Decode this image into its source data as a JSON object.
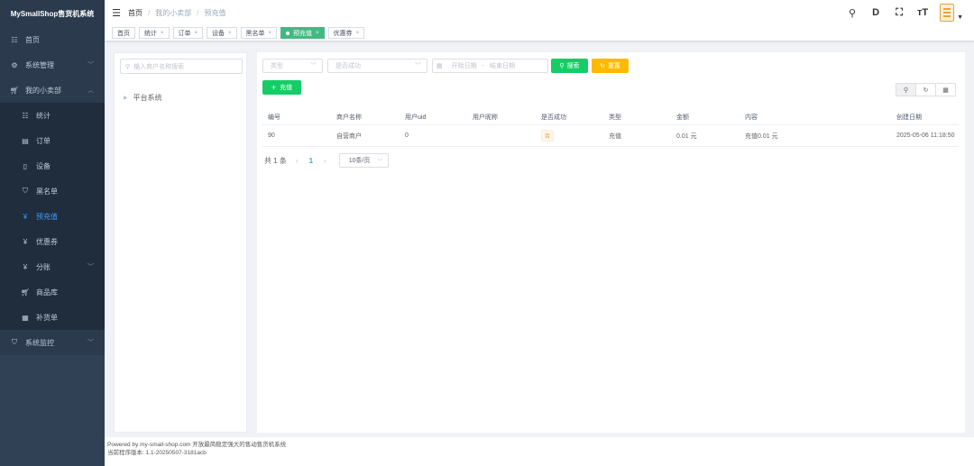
{
  "app": {
    "title": "MySmallShop售货机系统"
  },
  "sidebar": {
    "items": [
      {
        "label": "首页",
        "icon": "dashboard-icon"
      },
      {
        "label": "系统管理",
        "icon": "gear-icon"
      },
      {
        "label": "我的小卖部",
        "icon": "cart-icon"
      },
      {
        "label": "系统监控",
        "icon": "monitor-icon"
      }
    ],
    "sub_items": [
      {
        "label": "统计",
        "icon": "chart-icon"
      },
      {
        "label": "订单",
        "icon": "order-icon"
      },
      {
        "label": "设备",
        "icon": "device-icon"
      },
      {
        "label": "黑名单",
        "icon": "shield-icon"
      },
      {
        "label": "预充值",
        "icon": "yen-icon"
      },
      {
        "label": "优惠券",
        "icon": "yen-icon"
      },
      {
        "label": "分账",
        "icon": "yen-icon"
      },
      {
        "label": "商品库",
        "icon": "cart-icon"
      },
      {
        "label": "补货单",
        "icon": "calendar-icon"
      }
    ]
  },
  "breadcrumb": {
    "home": "首页",
    "parent": "我的小卖部",
    "current": "预充值"
  },
  "tags": [
    {
      "label": "首页"
    },
    {
      "label": "统计"
    },
    {
      "label": "订单"
    },
    {
      "label": "设备"
    },
    {
      "label": "黑名单"
    },
    {
      "label": "预充值"
    },
    {
      "label": "优惠券"
    }
  ],
  "tree": {
    "search_placeholder": "输入商户名称搜索",
    "node": "平台系统"
  },
  "filters": {
    "type_placeholder": "类型",
    "success_placeholder": "是否成功",
    "start_date_placeholder": "开始日期",
    "date_sep": "-",
    "end_date_placeholder": "结束日期",
    "search_label": "搜索",
    "reset_label": "重置",
    "add_label": "充值"
  },
  "table": {
    "columns": [
      "编号",
      "商户名称",
      "用户uid",
      "用户昵称",
      "是否成功",
      "类型",
      "金额",
      "内容",
      "创建日期"
    ],
    "rows": [
      {
        "id": "90",
        "merchant": "自营商户",
        "uid": "0",
        "nickname": "",
        "success": "否",
        "type": "充值",
        "amount": "0.01 元",
        "content": "充值0.01 元",
        "created": "2025-05-06 11:18:50"
      }
    ]
  },
  "pagination": {
    "total": "共 1 条",
    "page": "1",
    "page_size": "10条/页"
  },
  "footer": {
    "line1": "Powered by my-small-shop.com 开放最简稳定强大的售动售货机系统",
    "line2": "当前程序版本: 1.1-20250507-3181acb"
  },
  "colors": {
    "sidebar": "#304156",
    "accent": "#409eff",
    "success": "#13ce66",
    "warning": "#ffba00",
    "tag_active": "#42b983"
  }
}
